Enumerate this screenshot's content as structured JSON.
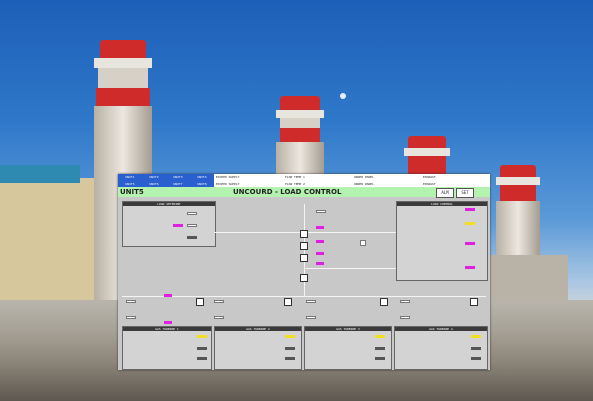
{
  "screen": {
    "unit_label": "UNIT5",
    "title": "UNCOURD - LOAD CONTROL",
    "top_left_cells": [
      "UNIT1",
      "UNIT2",
      "UNIT3",
      "UNIT4",
      "UNIT5",
      "UNIT6",
      "UNIT7",
      "UNIT8"
    ],
    "top_right_cells": [
      "EXCEED SUPPLY",
      "FLOW TEMP 1",
      "ORDER PANEL",
      "EXHAUST",
      "EXCEED SUPPLY",
      "FLOW TEMP 2",
      "ORDER PANEL",
      "EXHAUST"
    ],
    "buttons": [
      "ALM",
      "SET"
    ],
    "panels": {
      "top_left": "LOAD SETPOINT",
      "top_right": "LOAD CONTROL",
      "bottom": [
        "GAS TURBINE 1",
        "GAS TURBINE 2",
        "GAS TURBINE 3",
        "GAS TURBINE 4"
      ]
    }
  },
  "colors": {
    "accent": "#e020e0",
    "title_bg": "#b4f2b0",
    "topbar_blue": "#2a5fcf"
  }
}
